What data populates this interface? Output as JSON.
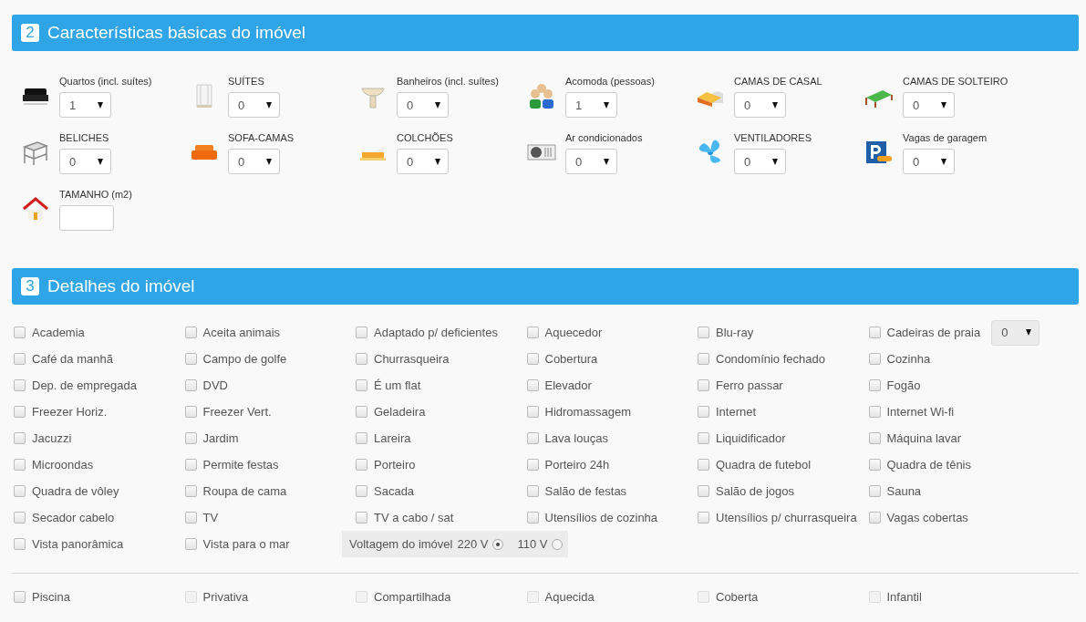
{
  "sections": [
    {
      "number": "2",
      "title": "Características básicas do imóvel"
    },
    {
      "number": "3",
      "title": "Detalhes do imóvel"
    }
  ],
  "basics": [
    {
      "kind": "select",
      "label": "Quartos (incl. suítes)",
      "value": "1"
    },
    {
      "kind": "select",
      "label": "SUÍTES",
      "value": "0"
    },
    {
      "kind": "select",
      "label": "Banheiros (incl. suítes)",
      "value": "0"
    },
    {
      "kind": "select",
      "label": "Acomoda (pessoas)",
      "value": "1"
    },
    {
      "kind": "select",
      "label": "CAMAS DE CASAL",
      "value": "0"
    },
    {
      "kind": "select",
      "label": "CAMAS DE SOLTEIRO",
      "value": "0"
    },
    {
      "kind": "select",
      "label": "BELICHES",
      "value": "0"
    },
    {
      "kind": "select",
      "label": "SOFA-CAMAS",
      "value": "0"
    },
    {
      "kind": "select",
      "label": "COLCHÕES",
      "value": "0"
    },
    {
      "kind": "select",
      "label": "Ar condicionados",
      "value": "0"
    },
    {
      "kind": "select",
      "label": "VENTILADORES",
      "value": "0"
    },
    {
      "kind": "select",
      "label": "Vagas de garagem",
      "value": "0"
    },
    {
      "kind": "input",
      "label": "TAMANHO (m2)"
    }
  ],
  "details": [
    {
      "kind": "checkbox",
      "label": "Academia",
      "checked": false
    },
    {
      "kind": "checkbox",
      "label": "Aceita animais",
      "checked": false
    },
    {
      "kind": "checkbox",
      "label": "Adaptado p/ deficientes",
      "checked": false
    },
    {
      "kind": "checkbox",
      "label": "Aquecedor",
      "checked": false
    },
    {
      "kind": "checkbox",
      "label": "Blu-ray",
      "checked": false
    },
    {
      "kind": "checkbox-select",
      "label": "Cadeiras de praia",
      "checked": false,
      "value": "0"
    },
    {
      "kind": "checkbox",
      "label": "Café da manhã",
      "checked": false
    },
    {
      "kind": "checkbox",
      "label": "Campo de golfe",
      "checked": false
    },
    {
      "kind": "checkbox",
      "label": "Churrasqueira",
      "checked": false
    },
    {
      "kind": "checkbox",
      "label": "Cobertura",
      "checked": false
    },
    {
      "kind": "checkbox",
      "label": "Condomínio fechado",
      "checked": false
    },
    {
      "kind": "checkbox",
      "label": "Cozinha",
      "checked": false
    },
    {
      "kind": "checkbox",
      "label": "Dep. de empregada",
      "checked": false
    },
    {
      "kind": "checkbox",
      "label": "DVD",
      "checked": false
    },
    {
      "kind": "checkbox",
      "label": "É um flat",
      "checked": false
    },
    {
      "kind": "checkbox",
      "label": "Elevador",
      "checked": false
    },
    {
      "kind": "checkbox",
      "label": "Ferro passar",
      "checked": false
    },
    {
      "kind": "checkbox",
      "label": "Fogão",
      "checked": false
    },
    {
      "kind": "checkbox",
      "label": "Freezer Horiz.",
      "checked": false
    },
    {
      "kind": "checkbox",
      "label": "Freezer Vert.",
      "checked": false
    },
    {
      "kind": "checkbox",
      "label": "Geladeira",
      "checked": false
    },
    {
      "kind": "checkbox",
      "label": "Hidromassagem",
      "checked": false
    },
    {
      "kind": "checkbox",
      "label": "Internet",
      "checked": false
    },
    {
      "kind": "checkbox",
      "label": "Internet Wi-fi",
      "checked": false
    },
    {
      "kind": "checkbox",
      "label": "Jacuzzi",
      "checked": false
    },
    {
      "kind": "checkbox",
      "label": "Jardim",
      "checked": false
    },
    {
      "kind": "checkbox",
      "label": "Lareira",
      "checked": false
    },
    {
      "kind": "checkbox",
      "label": "Lava louças",
      "checked": false
    },
    {
      "kind": "checkbox",
      "label": "Liquidificador",
      "checked": false
    },
    {
      "kind": "checkbox",
      "label": "Máquina lavar",
      "checked": false
    },
    {
      "kind": "checkbox",
      "label": "Microondas",
      "checked": false
    },
    {
      "kind": "checkbox",
      "label": "Permite festas",
      "checked": false
    },
    {
      "kind": "checkbox",
      "label": "Porteiro",
      "checked": false
    },
    {
      "kind": "checkbox",
      "label": "Porteiro 24h",
      "checked": false
    },
    {
      "kind": "checkbox",
      "label": "Quadra de futebol",
      "checked": false
    },
    {
      "kind": "checkbox",
      "label": "Quadra de tênis",
      "checked": false
    },
    {
      "kind": "checkbox",
      "label": "Quadra de vôley",
      "checked": false
    },
    {
      "kind": "checkbox",
      "label": "Roupa de cama",
      "checked": false
    },
    {
      "kind": "checkbox",
      "label": "Sacada",
      "checked": false
    },
    {
      "kind": "checkbox",
      "label": "Salão de festas",
      "checked": false
    },
    {
      "kind": "checkbox",
      "label": "Salão de jogos",
      "checked": false
    },
    {
      "kind": "checkbox",
      "label": "Sauna",
      "checked": false
    },
    {
      "kind": "checkbox",
      "label": "Secador cabelo",
      "checked": false
    },
    {
      "kind": "checkbox",
      "label": "TV",
      "checked": false
    },
    {
      "kind": "checkbox",
      "label": "TV a cabo / sat",
      "checked": false
    },
    {
      "kind": "checkbox",
      "label": "Utensílios de cozinha",
      "checked": false
    },
    {
      "kind": "checkbox",
      "label": "Utensílios p/ churrasqueira",
      "checked": false
    },
    {
      "kind": "checkbox",
      "label": "Vagas cobertas",
      "checked": false
    },
    {
      "kind": "checkbox",
      "label": "Vista panorâmica",
      "checked": false
    },
    {
      "kind": "checkbox",
      "label": "Vista para o mar",
      "checked": false
    },
    {
      "kind": "radio-group",
      "label": "Voltagem do imóvel",
      "options": [
        {
          "label": "220 V",
          "selected": true
        },
        {
          "label": "110 V",
          "selected": false
        }
      ]
    }
  ],
  "pool": [
    {
      "label": "Piscina",
      "checked": false,
      "disabled": false
    },
    {
      "label": "Privativa",
      "checked": false,
      "disabled": true
    },
    {
      "label": "Compartilhada",
      "checked": false,
      "disabled": true
    },
    {
      "label": "Aquecida",
      "checked": false,
      "disabled": true
    },
    {
      "label": "Coberta",
      "checked": false,
      "disabled": true
    },
    {
      "label": "Infantil",
      "checked": false,
      "disabled": true
    }
  ]
}
